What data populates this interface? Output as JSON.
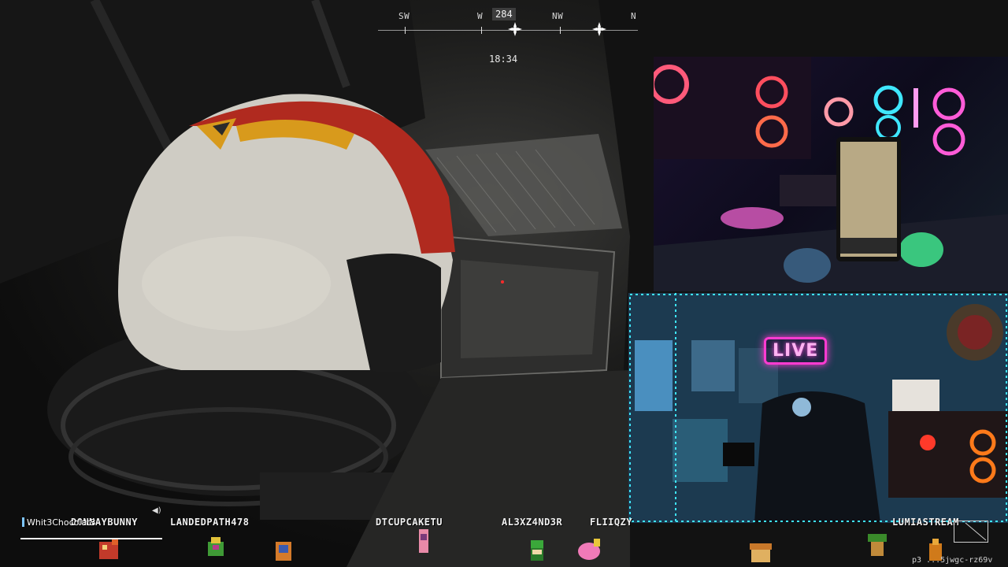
{
  "hud": {
    "compass": {
      "labels": [
        "SW",
        "W",
        "NW",
        "N"
      ],
      "heading": "284"
    },
    "clock": "18:34"
  },
  "webcam": {
    "live_sign": "LIVE"
  },
  "chat": {
    "user": "Whit3Chocolat3"
  },
  "viewers": [
    "DONNAYBUNNY",
    "LANDEDPATH478",
    "DTCUPCAKETU",
    "AL3XZ4ND3R",
    "FLIIQZY",
    "LUMIASTREAM"
  ],
  "session_code": "p3 ...5jwgc-rz69v",
  "colors": {
    "helmet_white": "#d9d6cf",
    "helmet_red": "#a8281e",
    "helmet_yellow": "#d89a1c",
    "neon_pink": "#ff3bd1",
    "neon_cyan": "#3fe7ff"
  },
  "icons": [
    "speaker-icon",
    "objective-marker-icon"
  ]
}
